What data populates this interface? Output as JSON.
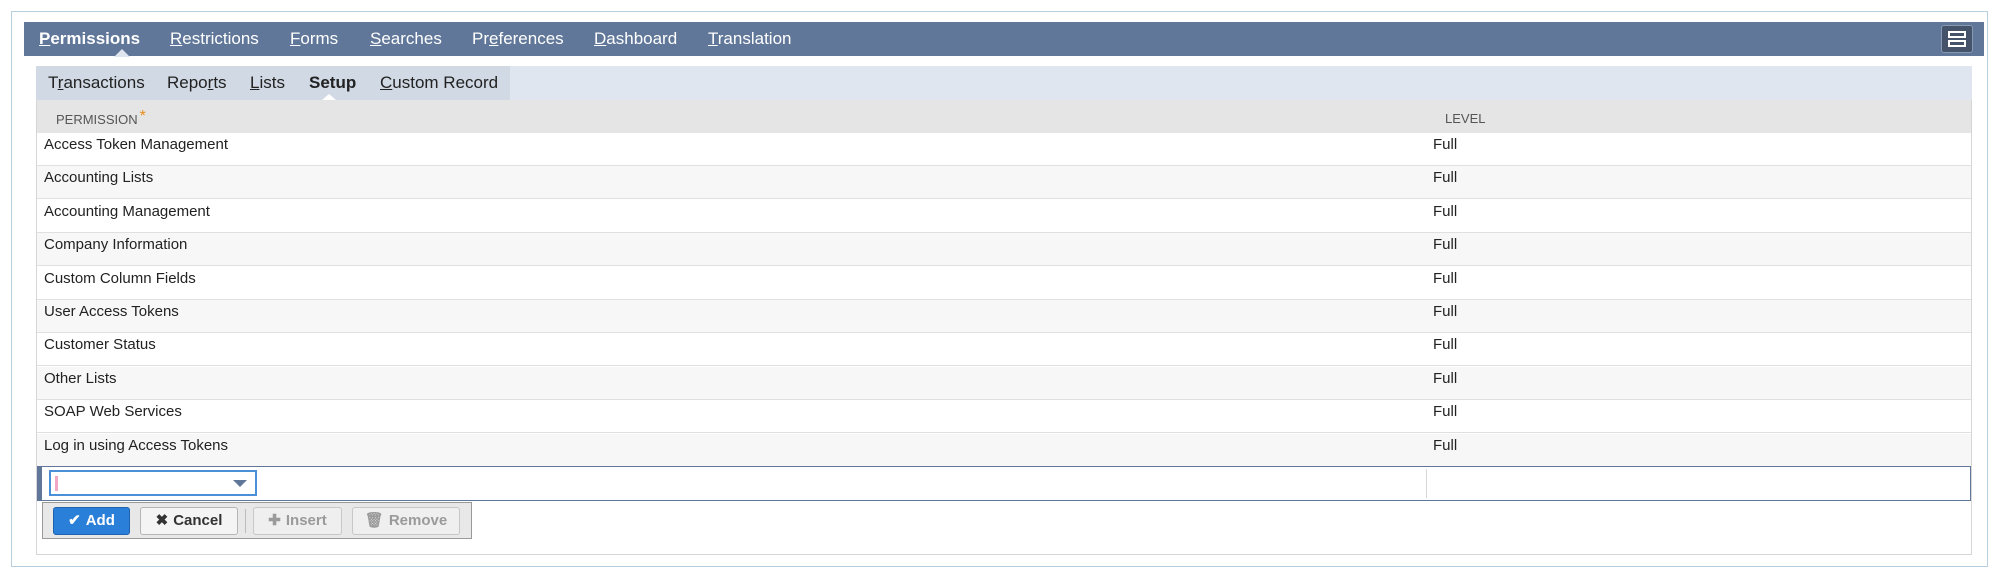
{
  "topnav": {
    "items": [
      {
        "label": "Permissions",
        "active": true
      },
      {
        "label": "Restrictions"
      },
      {
        "label": "Forms"
      },
      {
        "label": "Searches"
      },
      {
        "label": "Preferences"
      },
      {
        "label": "Dashboard"
      },
      {
        "label": "Translation"
      }
    ],
    "layout_icon": "layout-toggle-icon"
  },
  "subtabs": {
    "items": [
      {
        "label": "Transactions"
      },
      {
        "label": "Reports"
      },
      {
        "label": "Lists"
      },
      {
        "label": "Setup",
        "active": true
      },
      {
        "label": "Custom Record"
      }
    ]
  },
  "table": {
    "headers": {
      "permission": "PERMISSION",
      "required_mark": "*",
      "level": "LEVEL"
    },
    "rows": [
      {
        "permission": "Access Token Management",
        "level": "Full"
      },
      {
        "permission": "Accounting Lists",
        "level": "Full"
      },
      {
        "permission": "Accounting Management",
        "level": "Full"
      },
      {
        "permission": "Company Information",
        "level": "Full"
      },
      {
        "permission": "Custom Column Fields",
        "level": "Full"
      },
      {
        "permission": "User Access Tokens",
        "level": "Full"
      },
      {
        "permission": "Customer Status",
        "level": "Full"
      },
      {
        "permission": "Other Lists",
        "level": "Full"
      },
      {
        "permission": "SOAP Web Services",
        "level": "Full"
      },
      {
        "permission": "Log in using Access Tokens",
        "level": "Full"
      }
    ]
  },
  "editor": {
    "permission_value": "",
    "level_value": ""
  },
  "buttons": {
    "add": "Add",
    "cancel": "Cancel",
    "insert": "Insert",
    "remove": "Remove"
  },
  "colors": {
    "nav_bg": "#607799",
    "subbar_bg": "#dfe6ef",
    "primary_button": "#2a7fd9",
    "required_mark": "#e88f1e"
  }
}
